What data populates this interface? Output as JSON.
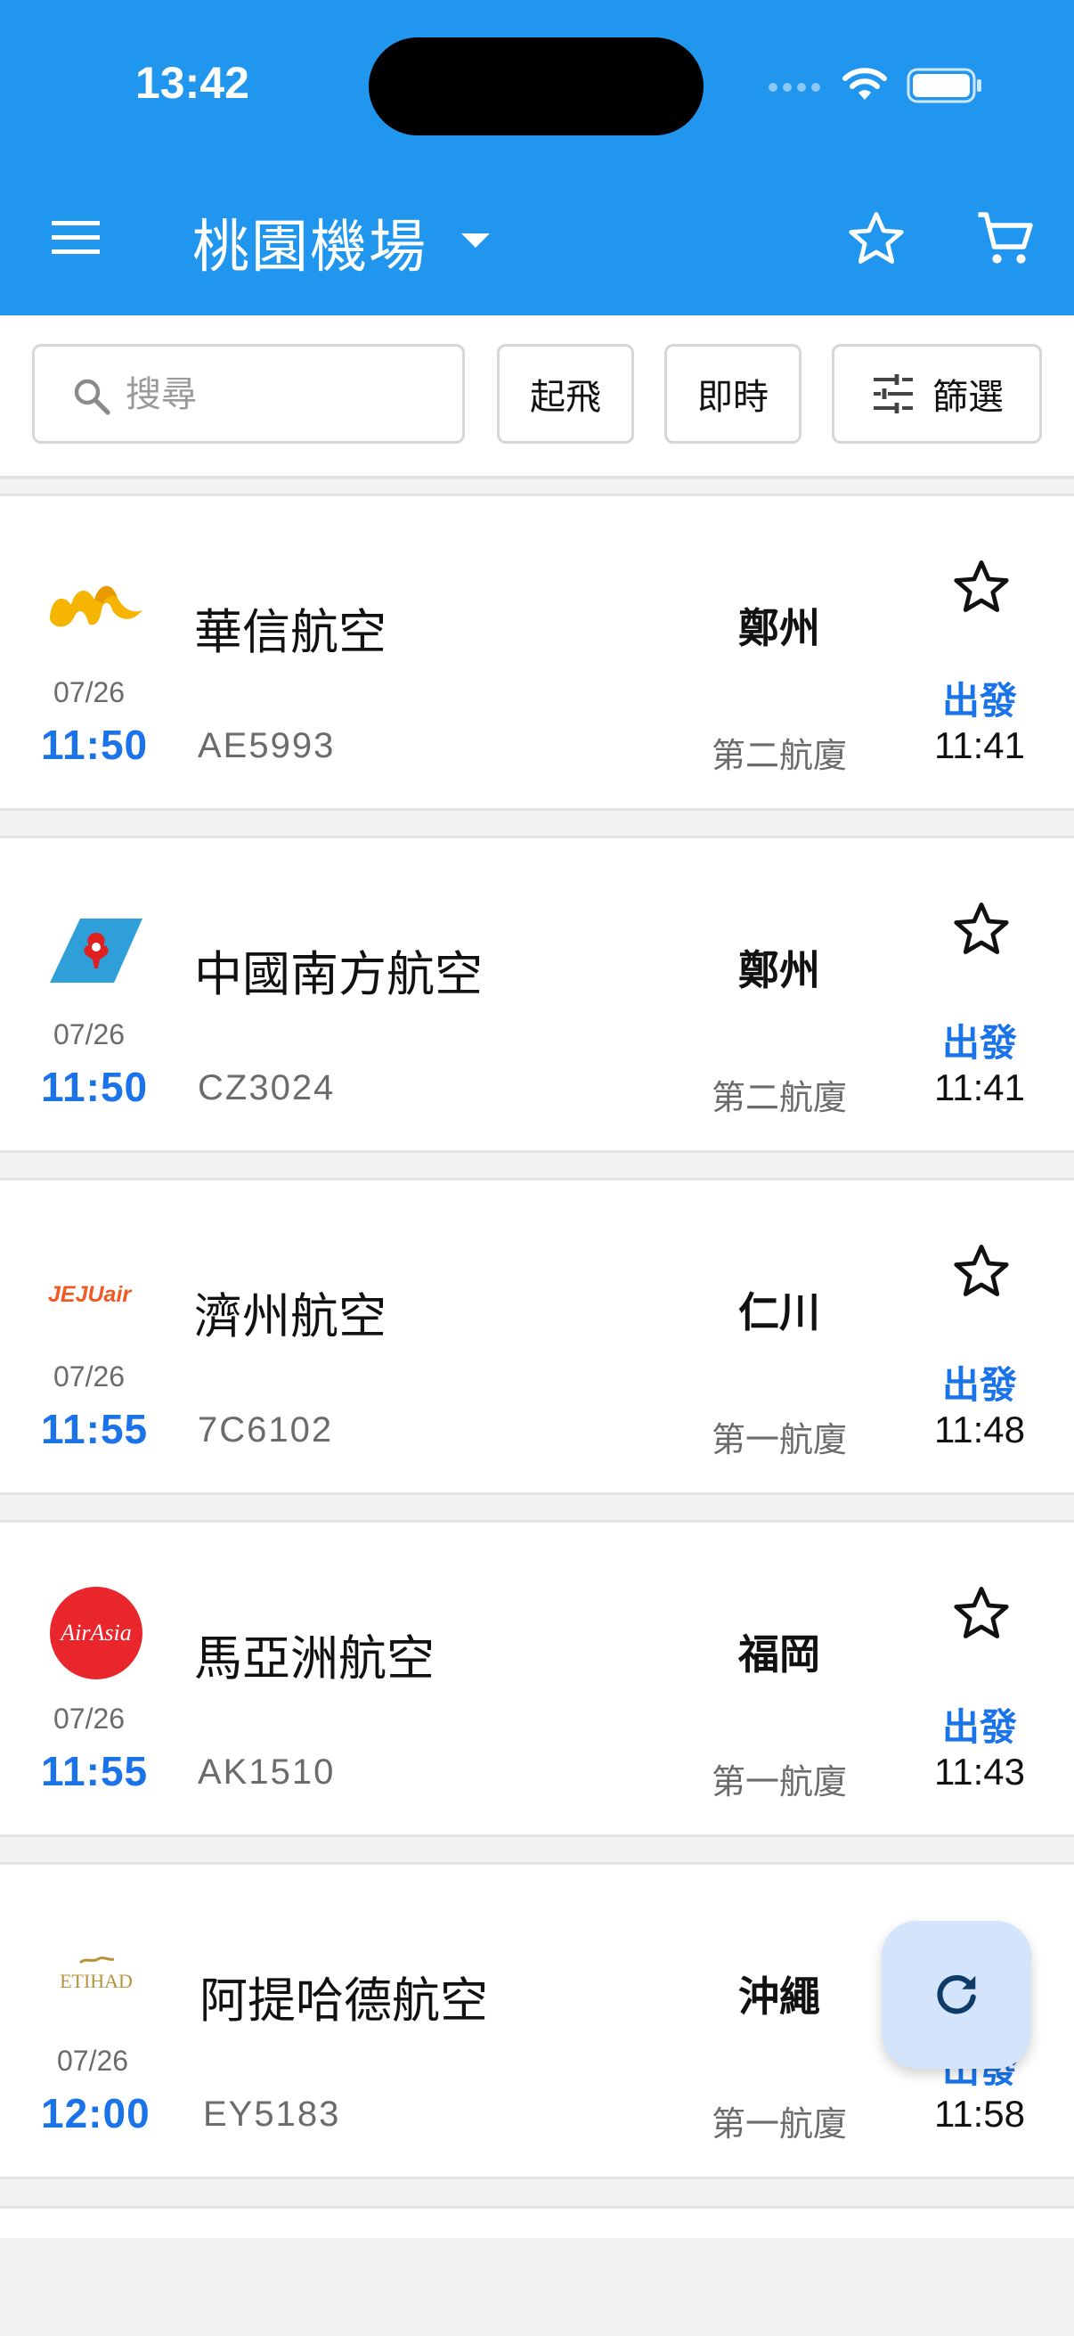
{
  "status_bar": {
    "time": "13:42"
  },
  "header": {
    "title": "桃園機場"
  },
  "toolbar": {
    "search_placeholder": "搜尋",
    "departure_label": "起飛",
    "live_label": "即時",
    "filter_label": "篩選"
  },
  "colors": {
    "header": "#2196ee",
    "accent": "#1a73e8",
    "fab": "#d3e4fb"
  },
  "flights": [
    {
      "airline": "華信航空",
      "logo": "mandarin-airlines-logo",
      "date": "07/26",
      "scheduled": "11:50",
      "flight_no": "AE5993",
      "destination": "鄭州",
      "terminal": "第二航廈",
      "status": "出發",
      "actual": "11:41"
    },
    {
      "airline": "中國南方航空",
      "logo": "china-southern-logo",
      "date": "07/26",
      "scheduled": "11:50",
      "flight_no": "CZ3024",
      "destination": "鄭州",
      "terminal": "第二航廈",
      "status": "出發",
      "actual": "11:41"
    },
    {
      "airline": "濟州航空",
      "logo": "jejuair-logo",
      "logo_text": "JEJUair",
      "date": "07/26",
      "scheduled": "11:55",
      "flight_no": "7C6102",
      "destination": "仁川",
      "terminal": "第一航廈",
      "status": "出發",
      "actual": "11:48"
    },
    {
      "airline": "馬亞洲航空",
      "logo": "airasia-logo",
      "logo_text": "AirAsia",
      "date": "07/26",
      "scheduled": "11:55",
      "flight_no": "AK1510",
      "destination": "福岡",
      "terminal": "第一航廈",
      "status": "出發",
      "actual": "11:43"
    },
    {
      "airline": "阿提哈德航空",
      "logo": "etihad-logo",
      "logo_text": "ETIHAD",
      "date": "07/26",
      "scheduled": "12:00",
      "flight_no": "EY5183",
      "destination": "沖繩",
      "terminal": "第一航廈",
      "status": "出發",
      "actual": "11:58"
    }
  ]
}
